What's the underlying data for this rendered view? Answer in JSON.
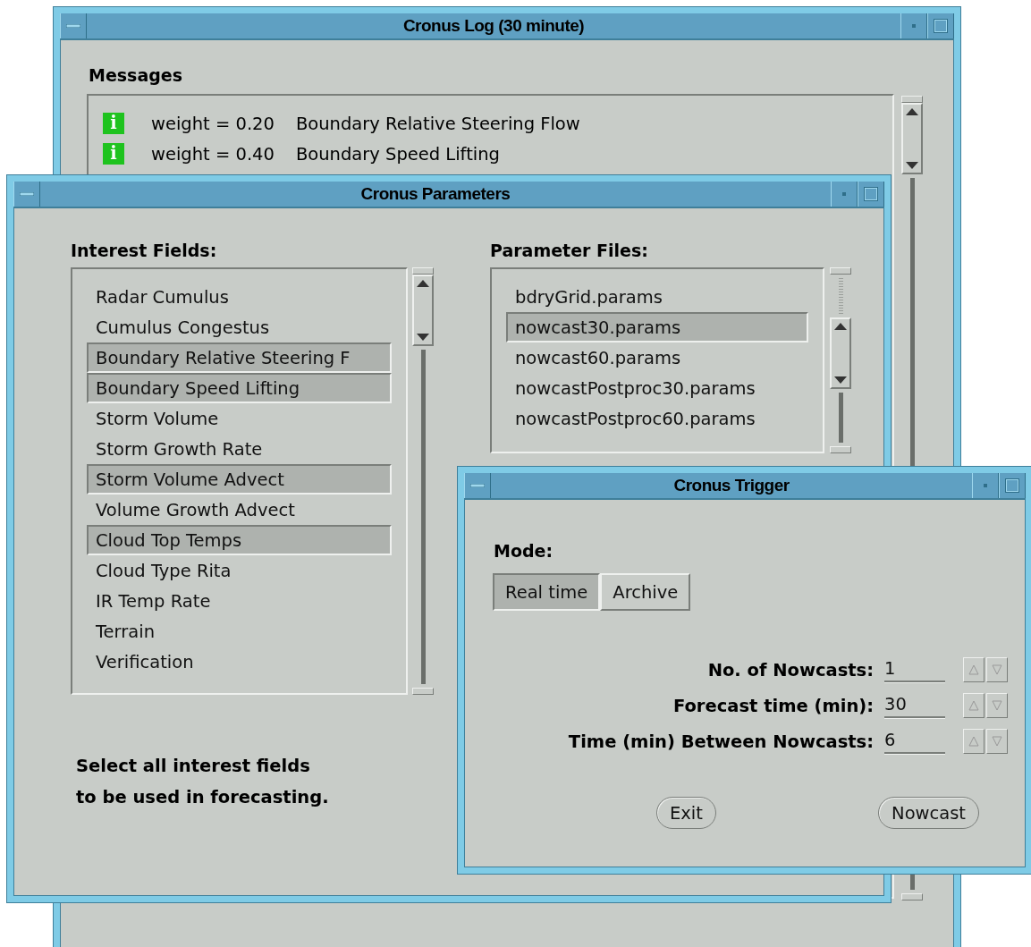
{
  "log_window": {
    "title": "Cronus Log (30 minute)",
    "heading": "Messages",
    "messages": [
      {
        "kind": "info",
        "icon": "i",
        "weight": "weight = 0.20",
        "text": "Boundary Relative Steering Flow"
      },
      {
        "kind": "info",
        "icon": "i",
        "weight": "weight = 0.40",
        "text": "Boundary Speed Lifting"
      }
    ]
  },
  "parameters_window": {
    "title": "Cronus Parameters",
    "interest_fields": {
      "label": "Interest Fields:",
      "items": [
        {
          "label": "Radar Cumulus",
          "selected": false
        },
        {
          "label": "Cumulus Congestus",
          "selected": false
        },
        {
          "label": "Boundary Relative Steering F",
          "selected": true
        },
        {
          "label": "Boundary Speed Lifting",
          "selected": true
        },
        {
          "label": "Storm Volume",
          "selected": false
        },
        {
          "label": "Storm Growth Rate",
          "selected": false
        },
        {
          "label": "Storm Volume Advect",
          "selected": true
        },
        {
          "label": "Volume Growth Advect",
          "selected": false
        },
        {
          "label": "Cloud Top Temps",
          "selected": true
        },
        {
          "label": "Cloud Type Rita",
          "selected": false
        },
        {
          "label": "IR Temp Rate",
          "selected": false
        },
        {
          "label": "Terrain",
          "selected": false
        },
        {
          "label": "Verification",
          "selected": false
        }
      ]
    },
    "parameter_files": {
      "label": "Parameter Files:",
      "items": [
        {
          "label": "bdryGrid.params",
          "selected": false
        },
        {
          "label": "nowcast30.params",
          "selected": true
        },
        {
          "label": "nowcast60.params",
          "selected": false
        },
        {
          "label": "nowcastPostproc30.params",
          "selected": false
        },
        {
          "label": "nowcastPostproc60.params",
          "selected": false
        }
      ]
    },
    "hint": [
      "Select all interest fields",
      "to be used in forecasting."
    ]
  },
  "trigger_window": {
    "title": "Cronus Trigger",
    "mode_label": "Mode:",
    "modes": [
      {
        "label": "Real time",
        "selected": true
      },
      {
        "label": "Archive",
        "selected": false
      }
    ],
    "fields": [
      {
        "label": "No. of Nowcasts:",
        "value": "1"
      },
      {
        "label": "Forecast time (min):",
        "value": "30"
      },
      {
        "label": "Time (min) Between Nowcasts:",
        "value": "6"
      }
    ],
    "buttons": [
      "Exit",
      "Nowcast"
    ]
  }
}
